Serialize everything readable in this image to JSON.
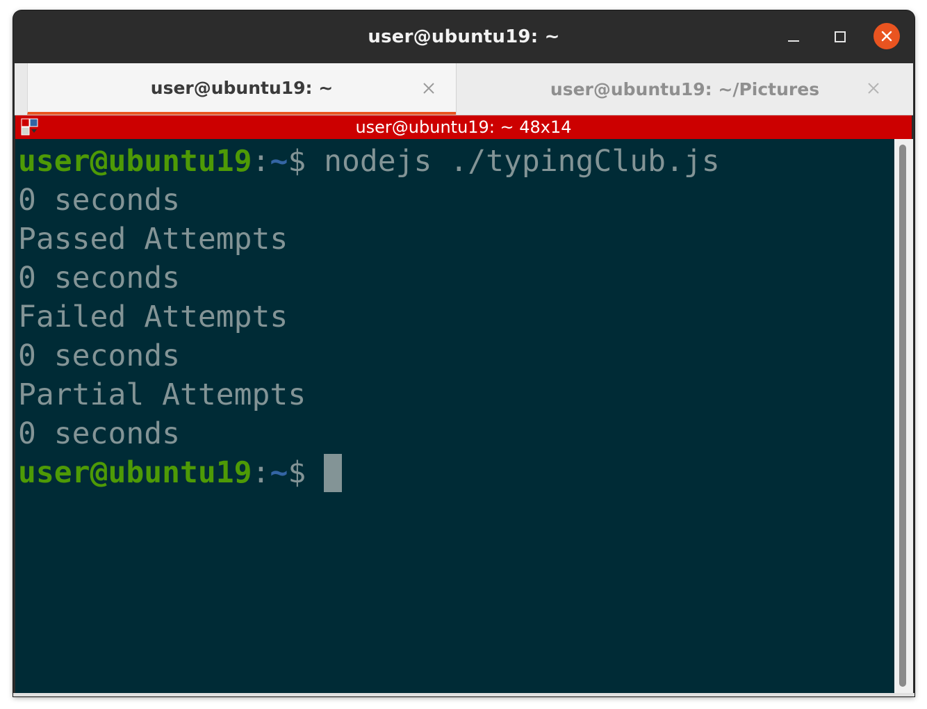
{
  "window": {
    "title": "user@ubuntu19: ~",
    "controls": {
      "minimize": "minimize-icon",
      "maximize": "maximize-icon",
      "close": "close-icon"
    },
    "close_color": "#e95420"
  },
  "tabs": [
    {
      "label": "user@ubuntu19: ~",
      "active": true
    },
    {
      "label": "user@ubuntu19: ~/Pictures",
      "active": false
    }
  ],
  "statusbar": {
    "text": "user@ubuntu19: ~ 48x14",
    "color": "#cc0000",
    "icon": "terminal-window-icon"
  },
  "terminal": {
    "background": "#002b36",
    "foreground": "#839496",
    "prompt": {
      "user": "user@ubuntu19",
      "colon": ":",
      "path": "~",
      "dollar": "$"
    },
    "command": " nodejs ./typingClub.js",
    "output": [
      "0 seconds",
      "Passed Attempts",
      "0 seconds",
      "Failed Attempts",
      "0 seconds",
      "Partial Attempts",
      "0 seconds"
    ]
  }
}
